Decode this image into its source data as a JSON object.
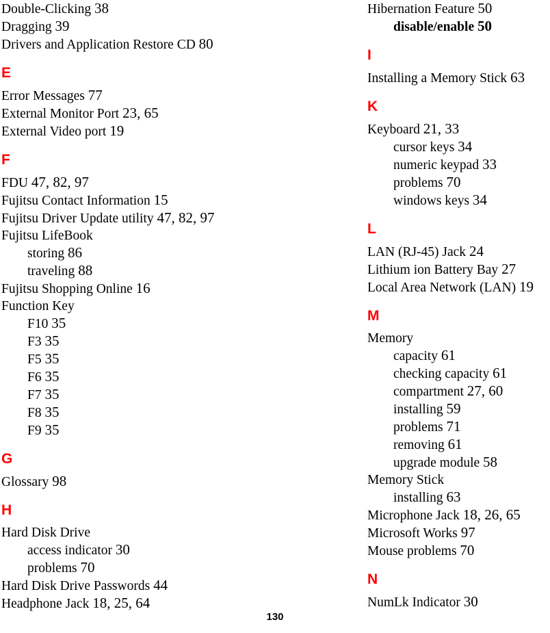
{
  "document": {
    "page_number": "130",
    "heading_color": "#ff0000",
    "text_color": "#000000"
  },
  "columns": [
    {
      "name": "left",
      "blocks": [
        {
          "heading": null,
          "entries": [
            {
              "label": "Double-Clicking",
              "pages": "38",
              "sub": false,
              "bold": false
            },
            {
              "label": "Dragging",
              "pages": "39",
              "sub": false,
              "bold": false
            },
            {
              "label": "Drivers and Application Restore CD",
              "pages": "80",
              "sub": false,
              "bold": false
            }
          ]
        },
        {
          "heading": "E",
          "entries": [
            {
              "label": "Error Messages",
              "pages": "77",
              "sub": false,
              "bold": false
            },
            {
              "label": "External Monitor Port",
              "pages": "23, 65",
              "sub": false,
              "bold": false
            },
            {
              "label": "External Video port",
              "pages": "19",
              "sub": false,
              "bold": false
            }
          ]
        },
        {
          "heading": "F",
          "entries": [
            {
              "label": "FDU",
              "pages": "47, 82, 97",
              "sub": false,
              "bold": false
            },
            {
              "label": "Fujitsu Contact Information",
              "pages": "15",
              "sub": false,
              "bold": false
            },
            {
              "label": "Fujitsu Driver Update utility",
              "pages": "47, 82, 97",
              "sub": false,
              "bold": false
            },
            {
              "label": "Fujitsu LifeBook",
              "pages": "",
              "sub": false,
              "bold": false
            },
            {
              "label": "storing",
              "pages": "86",
              "sub": true,
              "bold": false
            },
            {
              "label": "traveling",
              "pages": "88",
              "sub": true,
              "bold": false
            },
            {
              "label": "Fujitsu Shopping Online",
              "pages": "16",
              "sub": false,
              "bold": false
            },
            {
              "label": "Function Key",
              "pages": "",
              "sub": false,
              "bold": false
            },
            {
              "label": "F10",
              "pages": "35",
              "sub": true,
              "bold": false
            },
            {
              "label": "F3",
              "pages": "35",
              "sub": true,
              "bold": false
            },
            {
              "label": "F5",
              "pages": "35",
              "sub": true,
              "bold": false
            },
            {
              "label": "F6",
              "pages": "35",
              "sub": true,
              "bold": false
            },
            {
              "label": "F7",
              "pages": "35",
              "sub": true,
              "bold": false
            },
            {
              "label": "F8",
              "pages": "35",
              "sub": true,
              "bold": false
            },
            {
              "label": "F9",
              "pages": "35",
              "sub": true,
              "bold": false
            }
          ]
        },
        {
          "heading": "G",
          "entries": [
            {
              "label": "Glossary",
              "pages": "98",
              "sub": false,
              "bold": false
            }
          ]
        },
        {
          "heading": "H",
          "entries": [
            {
              "label": "Hard Disk Drive",
              "pages": "",
              "sub": false,
              "bold": false
            },
            {
              "label": "access indicator",
              "pages": "30",
              "sub": true,
              "bold": false
            },
            {
              "label": "problems",
              "pages": "70",
              "sub": true,
              "bold": false
            },
            {
              "label": "Hard Disk Drive Passwords",
              "pages": "44",
              "sub": false,
              "bold": false
            },
            {
              "label": "Headphone Jack",
              "pages": "18, 25, 64",
              "sub": false,
              "bold": false
            }
          ]
        }
      ]
    },
    {
      "name": "right",
      "blocks": [
        {
          "heading": null,
          "entries": [
            {
              "label": "Hibernation Feature",
              "pages": "50",
              "sub": false,
              "bold": false
            },
            {
              "label": "disable/enable",
              "pages": "50",
              "sub": true,
              "bold": true
            }
          ]
        },
        {
          "heading": "I",
          "entries": [
            {
              "label": "Installing a Memory Stick",
              "pages": "63",
              "sub": false,
              "bold": false
            }
          ]
        },
        {
          "heading": "K",
          "entries": [
            {
              "label": "Keyboard",
              "pages": "21, 33",
              "sub": false,
              "bold": false
            },
            {
              "label": "cursor keys",
              "pages": "34",
              "sub": true,
              "bold": false
            },
            {
              "label": "numeric keypad",
              "pages": "33",
              "sub": true,
              "bold": false
            },
            {
              "label": "problems",
              "pages": "70",
              "sub": true,
              "bold": false
            },
            {
              "label": "windows keys",
              "pages": "34",
              "sub": true,
              "bold": false
            }
          ]
        },
        {
          "heading": "L",
          "entries": [
            {
              "label": "LAN (RJ-45) Jack",
              "pages": "24",
              "sub": false,
              "bold": false
            },
            {
              "label": "Lithium ion Battery Bay",
              "pages": "27",
              "sub": false,
              "bold": false
            },
            {
              "label": "Local Area Network (LAN)",
              "pages": "19",
              "sub": false,
              "bold": false
            }
          ]
        },
        {
          "heading": "M",
          "entries": [
            {
              "label": "Memory",
              "pages": "",
              "sub": false,
              "bold": false
            },
            {
              "label": "capacity",
              "pages": "61",
              "sub": true,
              "bold": false
            },
            {
              "label": "checking capacity",
              "pages": "61",
              "sub": true,
              "bold": false
            },
            {
              "label": "compartment",
              "pages": "27, 60",
              "sub": true,
              "bold": false
            },
            {
              "label": "installing",
              "pages": "59",
              "sub": true,
              "bold": false
            },
            {
              "label": "problems",
              "pages": "71",
              "sub": true,
              "bold": false
            },
            {
              "label": "removing",
              "pages": "61",
              "sub": true,
              "bold": false
            },
            {
              "label": "upgrade module",
              "pages": "58",
              "sub": true,
              "bold": false
            },
            {
              "label": "Memory Stick",
              "pages": "",
              "sub": false,
              "bold": false
            },
            {
              "label": "installing",
              "pages": "63",
              "sub": true,
              "bold": false
            },
            {
              "label": "Microphone Jack",
              "pages": "18, 26, 65",
              "sub": false,
              "bold": false
            },
            {
              "label": "Microsoft Works",
              "pages": "97",
              "sub": false,
              "bold": false
            },
            {
              "label": "Mouse problems",
              "pages": "70",
              "sub": false,
              "bold": false
            }
          ]
        },
        {
          "heading": "N",
          "entries": [
            {
              "label": "NumLk Indicator",
              "pages": "30",
              "sub": false,
              "bold": false
            }
          ]
        }
      ]
    }
  ]
}
